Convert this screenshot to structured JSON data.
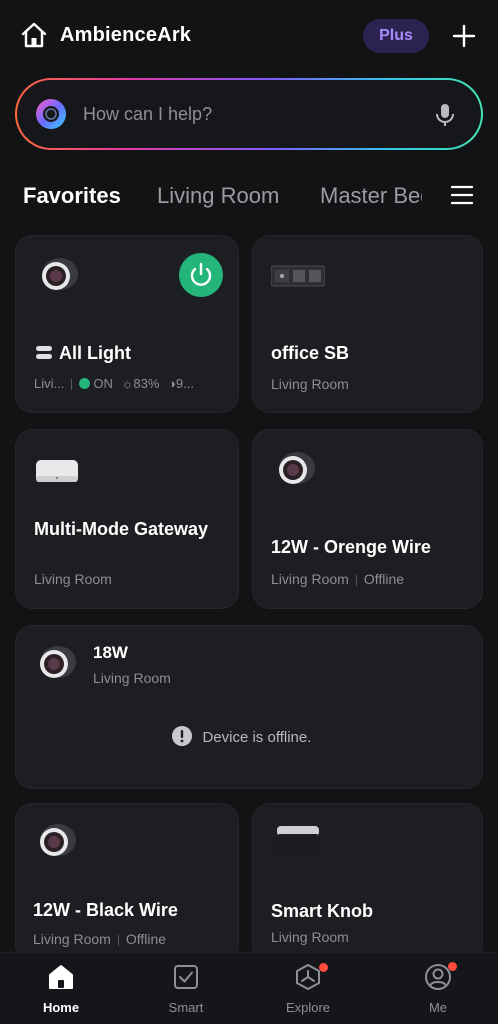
{
  "header": {
    "title": "AmbienceArk",
    "plus_label": "Plus",
    "icons": [
      "home-icon",
      "add-icon"
    ]
  },
  "search": {
    "placeholder": "How can I help?",
    "icons": [
      "assistant-icon",
      "mic-icon"
    ]
  },
  "tabs": [
    {
      "label": "Favorites",
      "active": true
    },
    {
      "label": "Living Room",
      "active": false
    },
    {
      "label": "Master Bedroom",
      "active": false
    }
  ],
  "cards": {
    "all_light": {
      "title": "All Light",
      "room": "Livi...",
      "status": "ON",
      "brightness": "83%",
      "color_temp": "9..."
    },
    "office_sb": {
      "title": "office SB",
      "room": "Living Room"
    },
    "gateway": {
      "title": "Multi-Mode Gateway",
      "room": "Living Room"
    },
    "orange_wire": {
      "title": "12W - Orenge Wire",
      "room": "Living Room",
      "status": "Offline"
    },
    "w18": {
      "title": "18W",
      "room": "Living Room",
      "offline_message": "Device is offline."
    },
    "black_wire": {
      "title": "12W - Black Wire",
      "room": "Living Room",
      "status": "Offline"
    },
    "smart_knob": {
      "title": "Smart Knob",
      "room": "Living Room"
    }
  },
  "bottom_nav": [
    {
      "label": "Home",
      "icon": "home-icon",
      "active": true
    },
    {
      "label": "Smart",
      "icon": "smart-check-icon",
      "active": false
    },
    {
      "label": "Explore",
      "icon": "explore-icon",
      "active": false,
      "badge": true
    },
    {
      "label": "Me",
      "icon": "profile-icon",
      "active": false,
      "badge": true
    }
  ],
  "colors": {
    "background": "#121315",
    "card": "#1d1e21",
    "power_on": "#23b57a",
    "plus_badge": "#2b2350",
    "plus_text": "#a78bfa",
    "notification": "#ff4b3e"
  }
}
